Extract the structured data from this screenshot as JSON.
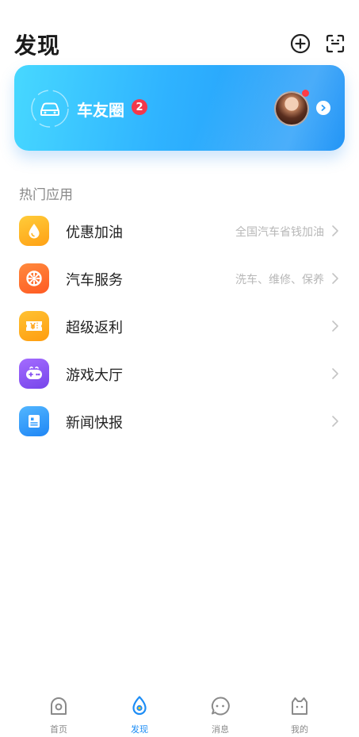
{
  "header": {
    "title": "发现"
  },
  "banner": {
    "title": "车友圈",
    "badge": "2"
  },
  "section": {
    "title": "热门应用"
  },
  "apps": [
    {
      "label": "优惠加油",
      "desc": "全国汽车省钱加油",
      "icon": "oil-drop-icon",
      "color": "#ffb21e"
    },
    {
      "label": "汽车服务",
      "desc": "洗车、维修、保养",
      "icon": "wheel-icon",
      "color": "#ff6a2b"
    },
    {
      "label": "超级返利",
      "desc": "",
      "icon": "coupon-icon",
      "color": "#ffaa16"
    },
    {
      "label": "游戏大厅",
      "desc": "",
      "icon": "gamepad-icon",
      "color": "#8a54f2"
    },
    {
      "label": "新闻快报",
      "desc": "",
      "icon": "news-icon",
      "color": "#2f9bff"
    }
  ],
  "tabs": [
    {
      "label": "首页",
      "icon": "home-icon"
    },
    {
      "label": "发现",
      "icon": "discover-icon",
      "active": true
    },
    {
      "label": "消息",
      "icon": "message-icon"
    },
    {
      "label": "我的",
      "icon": "profile-icon"
    }
  ],
  "colors": {
    "accent": "#1d8df5",
    "badge": "#f2384b"
  }
}
